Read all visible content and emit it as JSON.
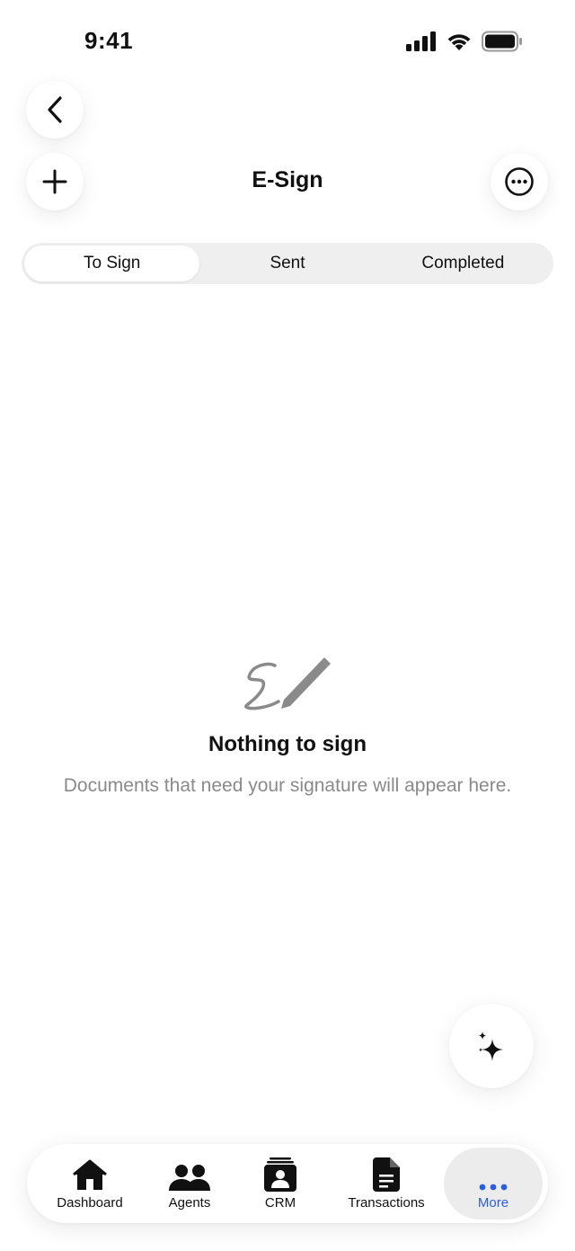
{
  "status_bar": {
    "time": "9:41"
  },
  "header": {
    "title": "E-Sign"
  },
  "tabs": [
    {
      "label": "To Sign",
      "active": true
    },
    {
      "label": "Sent",
      "active": false
    },
    {
      "label": "Completed",
      "active": false
    }
  ],
  "empty_state": {
    "icon": "signature-pen-icon",
    "title": "Nothing to sign",
    "description": "Documents that need your signature will appear here."
  },
  "bottom_nav": {
    "items": [
      {
        "label": "Dashboard",
        "icon": "home-icon"
      },
      {
        "label": "Agents",
        "icon": "people-icon"
      },
      {
        "label": "CRM",
        "icon": "contact-card-icon"
      },
      {
        "label": "Transactions",
        "icon": "document-icon"
      },
      {
        "label": "More",
        "icon": "ellipsis-icon",
        "active": true
      }
    ]
  },
  "colors": {
    "accent": "#2b5fd9",
    "muted_text": "#8a8a8a",
    "segment_bg": "#efefef",
    "active_nav_bg": "#ececec"
  }
}
